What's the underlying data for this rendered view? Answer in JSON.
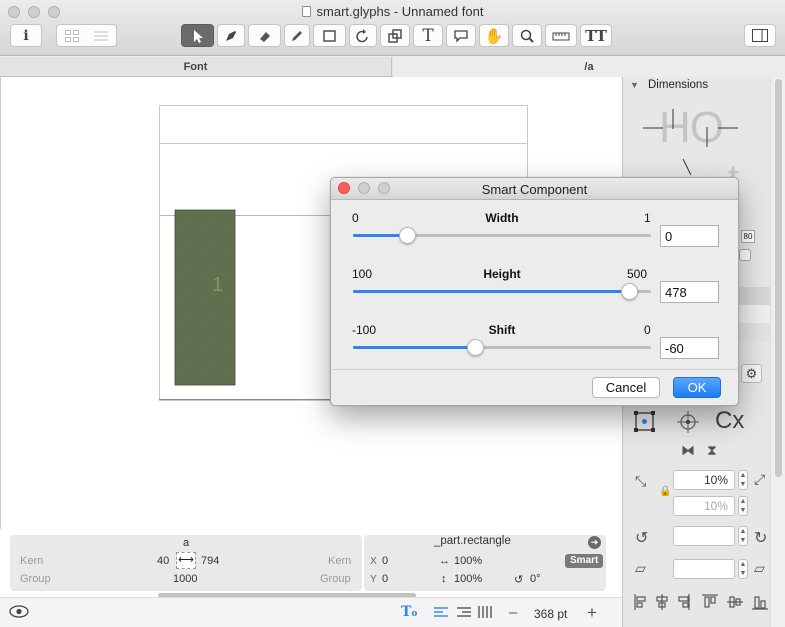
{
  "window": {
    "title": "smart.glyphs - Unnamed font"
  },
  "toolbar": {
    "tools": [
      "info-icon",
      "grid-view-icon",
      "list-view-icon",
      "select-tool-icon",
      "pen-tool-icon",
      "eraser-tool-icon",
      "pencil-tool-icon",
      "rectangle-tool-icon",
      "rotate-tool-icon",
      "scale-tool-icon",
      "text-tool-icon",
      "annotation-tool-icon",
      "hand-tool-icon",
      "zoom-tool-icon",
      "measure-tool-icon",
      "text-columns-icon",
      "sidebar-toggle-icon"
    ]
  },
  "tabs": [
    {
      "label": "Font"
    },
    {
      "label": "/a"
    }
  ],
  "canvas": {
    "component_index": "1",
    "fill_color": "#5b6b4c",
    "accent_color": "#6f8a4a"
  },
  "dialog": {
    "title": "Smart Component",
    "sliders": [
      {
        "name": "Width",
        "min": "0",
        "max": "1",
        "value": "0",
        "position": 0.18
      },
      {
        "name": "Height",
        "min": "100",
        "max": "500",
        "value": "478",
        "position": 0.925
      },
      {
        "name": "Shift",
        "min": "-100",
        "max": "0",
        "value": "-60",
        "position": 0.41
      }
    ],
    "cancel_label": "Cancel",
    "ok_label": "OK",
    "accent_color": "#2e83f0"
  },
  "info": {
    "glyph_name": "a",
    "kern_label": "Kern",
    "group_label": "Group",
    "left_kern": "40",
    "width_value": "794",
    "group_value": "1000",
    "component_name": "_part.rectangle",
    "right_kern_label": "Kern",
    "right_group_label": "Group",
    "x_label": "X",
    "x_value": "0",
    "y_label": "Y",
    "y_value": "0",
    "scale_x": "100%",
    "scale_y": "100%",
    "rotation": "0°",
    "smart_badge": "Smart"
  },
  "statusbar": {
    "zoom_value": "368 pt",
    "zoom_minus": "–",
    "zoom_plus": "+"
  },
  "panel": {
    "section_title": "Dimensions",
    "preview_text_1": "HO",
    "preview_text_2": "t",
    "partial_value": "80",
    "scale_value": "10%",
    "scale_value_2": "10%",
    "transform_label": "Cx"
  }
}
